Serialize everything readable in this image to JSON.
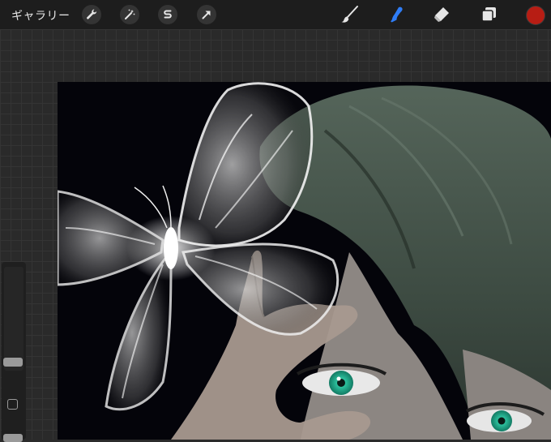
{
  "topbar": {
    "gallery_label": "ギャラリー",
    "left_tools": [
      "wrench-icon",
      "magic-wand-icon",
      "selection-s-icon",
      "transform-arrow-icon"
    ],
    "right_tools": [
      "brush-icon",
      "smudge-icon",
      "eraser-icon",
      "layers-icon"
    ],
    "active_tool": "smudge-icon",
    "active_color": "#b71d14",
    "active_tool_color": "#2f7df6"
  },
  "sidebar": {
    "brush_size_level": 0.15
  },
  "canvas": {
    "artwork": "illustration"
  }
}
